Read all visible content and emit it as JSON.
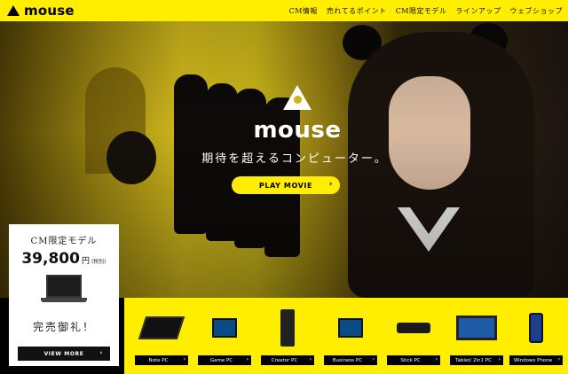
{
  "header": {
    "logo_text": "mouse",
    "nav": [
      "CM情報",
      "売れてるポイント",
      "CM限定モデル",
      "ラインアップ",
      "ウェブショップ"
    ]
  },
  "hero": {
    "brand_name": "mouse",
    "tagline": "期待を超えるコンピューター。",
    "play_button": "PLAY MOVIE"
  },
  "cm_model": {
    "title": "CM限定モデル",
    "price": "39,800",
    "currency": "円",
    "tax": "(税別)",
    "sold_out": "完売御礼！",
    "more_button": "VIEW MORE"
  },
  "lineup": [
    {
      "label": "Note PC",
      "icon": "laptop-icon"
    },
    {
      "label": "Game PC",
      "icon": "gaming-pc-icon"
    },
    {
      "label": "Creator PC",
      "icon": "tower-pc-icon"
    },
    {
      "label": "Business PC",
      "icon": "desktop-pc-icon"
    },
    {
      "label": "Stick PC",
      "icon": "stick-pc-icon"
    },
    {
      "label": "Tablet/ 2in1 PC",
      "icon": "tablet-icon"
    },
    {
      "label": "Windows Phone",
      "icon": "phone-icon"
    }
  ],
  "colors": {
    "accent": "#ffee00",
    "dark": "#000000"
  }
}
